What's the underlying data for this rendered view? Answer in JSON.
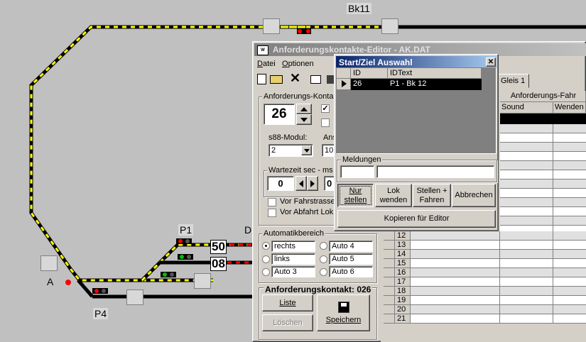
{
  "track": {
    "label_bk11": "Bk11",
    "label_p1": "P1",
    "label_p4": "P4",
    "label_a": "A",
    "label_d": "D",
    "number_50": "50",
    "number_08": "08"
  },
  "editor": {
    "title": "Anforderungskontakte-Editor - AK.DAT",
    "menu": {
      "datei": "Datei",
      "optionen": "Optionen"
    },
    "gleis_tab": "Gleis 1",
    "contact_group_label": "Anforderungs-Kontakt",
    "contact_number": "26",
    "s88_label": "s88-Modul:",
    "s88_value": "2",
    "anschluss_label": "Ans",
    "anschluss_value": "10",
    "wartezeit_label": "Wartezeit   sec - ms",
    "wartezeit_value": "0",
    "wartezeit_value2": "0",
    "vor_fahrstrasse": "Vor Fahrstrasse",
    "vor_abfahrt": "Vor Abfahrt Lok",
    "automatik_label": "Automatikbereich",
    "radio_rechts": "rechts",
    "radio_links": "links",
    "radio_auto3": "Auto 3",
    "radio_auto4": "Auto 4",
    "radio_auto5": "Auto 5",
    "radio_auto6": "Auto 6",
    "status_label": "Anforderungskontakt: 026",
    "liste_button": "Liste",
    "loeschen_button": "Löschen",
    "speichern_button": "Speichern",
    "grid_header_top": "Anforderungs-Fahr",
    "grid_col_sound": "Sound",
    "grid_col_wenden": "Wenden",
    "grid_rows": [
      "12",
      "13",
      "14",
      "15",
      "16",
      "17",
      "18",
      "19",
      "20",
      "21"
    ]
  },
  "dialog": {
    "title": "Start/Ziel Auswahl",
    "col_id": "ID",
    "col_idtext": "IDText",
    "row_id": "26",
    "row_text": "P1 - Bk 12",
    "meldungen_label": "Meldungen",
    "btn_nur_stellen_1": "Nur",
    "btn_nur_stellen_2": "stellen",
    "btn_lok_wenden_1": "Lok",
    "btn_lok_wenden_2": "wenden",
    "btn_stellen_fahren_1": "Stellen +",
    "btn_stellen_fahren_2": "Fahren",
    "btn_abbrechen": "Abbrechen",
    "btn_kopieren": "Kopieren für Editor"
  },
  "colors": {
    "title_active": "#0a246a",
    "title_active_end": "#a6caf0",
    "title_inactive": "#808080",
    "title_inactive_end": "#c0c0c0",
    "track_black": "#000000",
    "track_yellow": "#ffff00",
    "track_red": "#ff0000"
  }
}
